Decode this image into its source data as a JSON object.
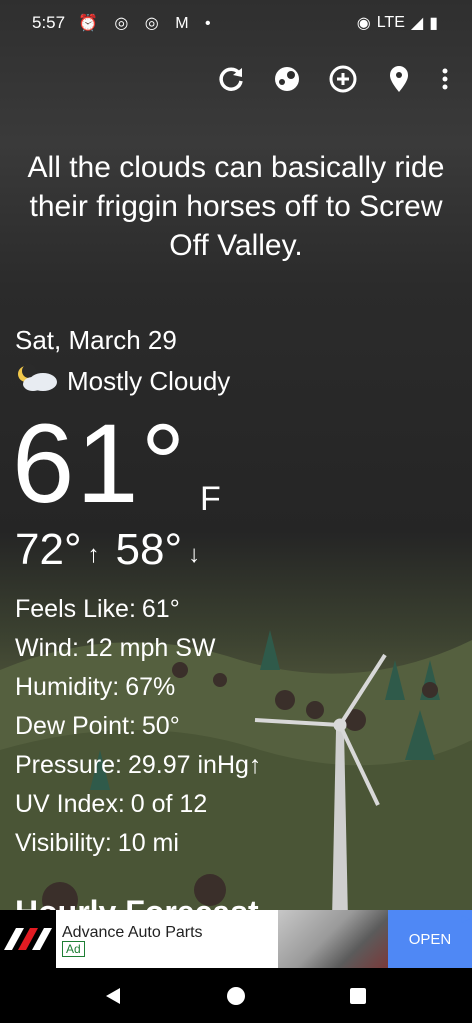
{
  "status": {
    "time": "5:57",
    "left_icons": [
      "alarm-icon",
      "instagram-icon",
      "instagram-icon",
      "gmail-icon",
      "dot-icon"
    ],
    "network": "LTE"
  },
  "toolbar": {
    "icons": [
      "refresh-icon",
      "radar-icon",
      "add-location-icon",
      "location-pin-icon",
      "overflow-menu-icon"
    ]
  },
  "headline": {
    "text": "All the clouds can basically ride their friggin horses off to Screw Off Valley."
  },
  "weather": {
    "date": "Sat, March 29",
    "condition": "Mostly Cloudy",
    "condition_icon": "partly-cloudy-night-icon",
    "temp": "61°",
    "unit": "F",
    "high": "72°",
    "low": "58°"
  },
  "details": [
    {
      "label": "Feels Like:",
      "value": "61°"
    },
    {
      "label": "Wind:",
      "value": "12 mph SW"
    },
    {
      "label": "Humidity:",
      "value": "67%"
    },
    {
      "label": "Dew Point:",
      "value": "50°"
    },
    {
      "label": "Pressure:",
      "value": "29.97 inHg↑"
    },
    {
      "label": "UV Index:",
      "value": "0 of 12"
    },
    {
      "label": "Visibility:",
      "value": "10 mi"
    }
  ],
  "next_section": {
    "title": "Hourly Forecast"
  },
  "ad": {
    "brand": "Advance Auto Parts",
    "badge": "Ad",
    "cta": "OPEN",
    "cta_color": "#4f88f5"
  },
  "navbar": {
    "buttons": [
      "back-icon",
      "home-icon",
      "recents-icon"
    ]
  }
}
